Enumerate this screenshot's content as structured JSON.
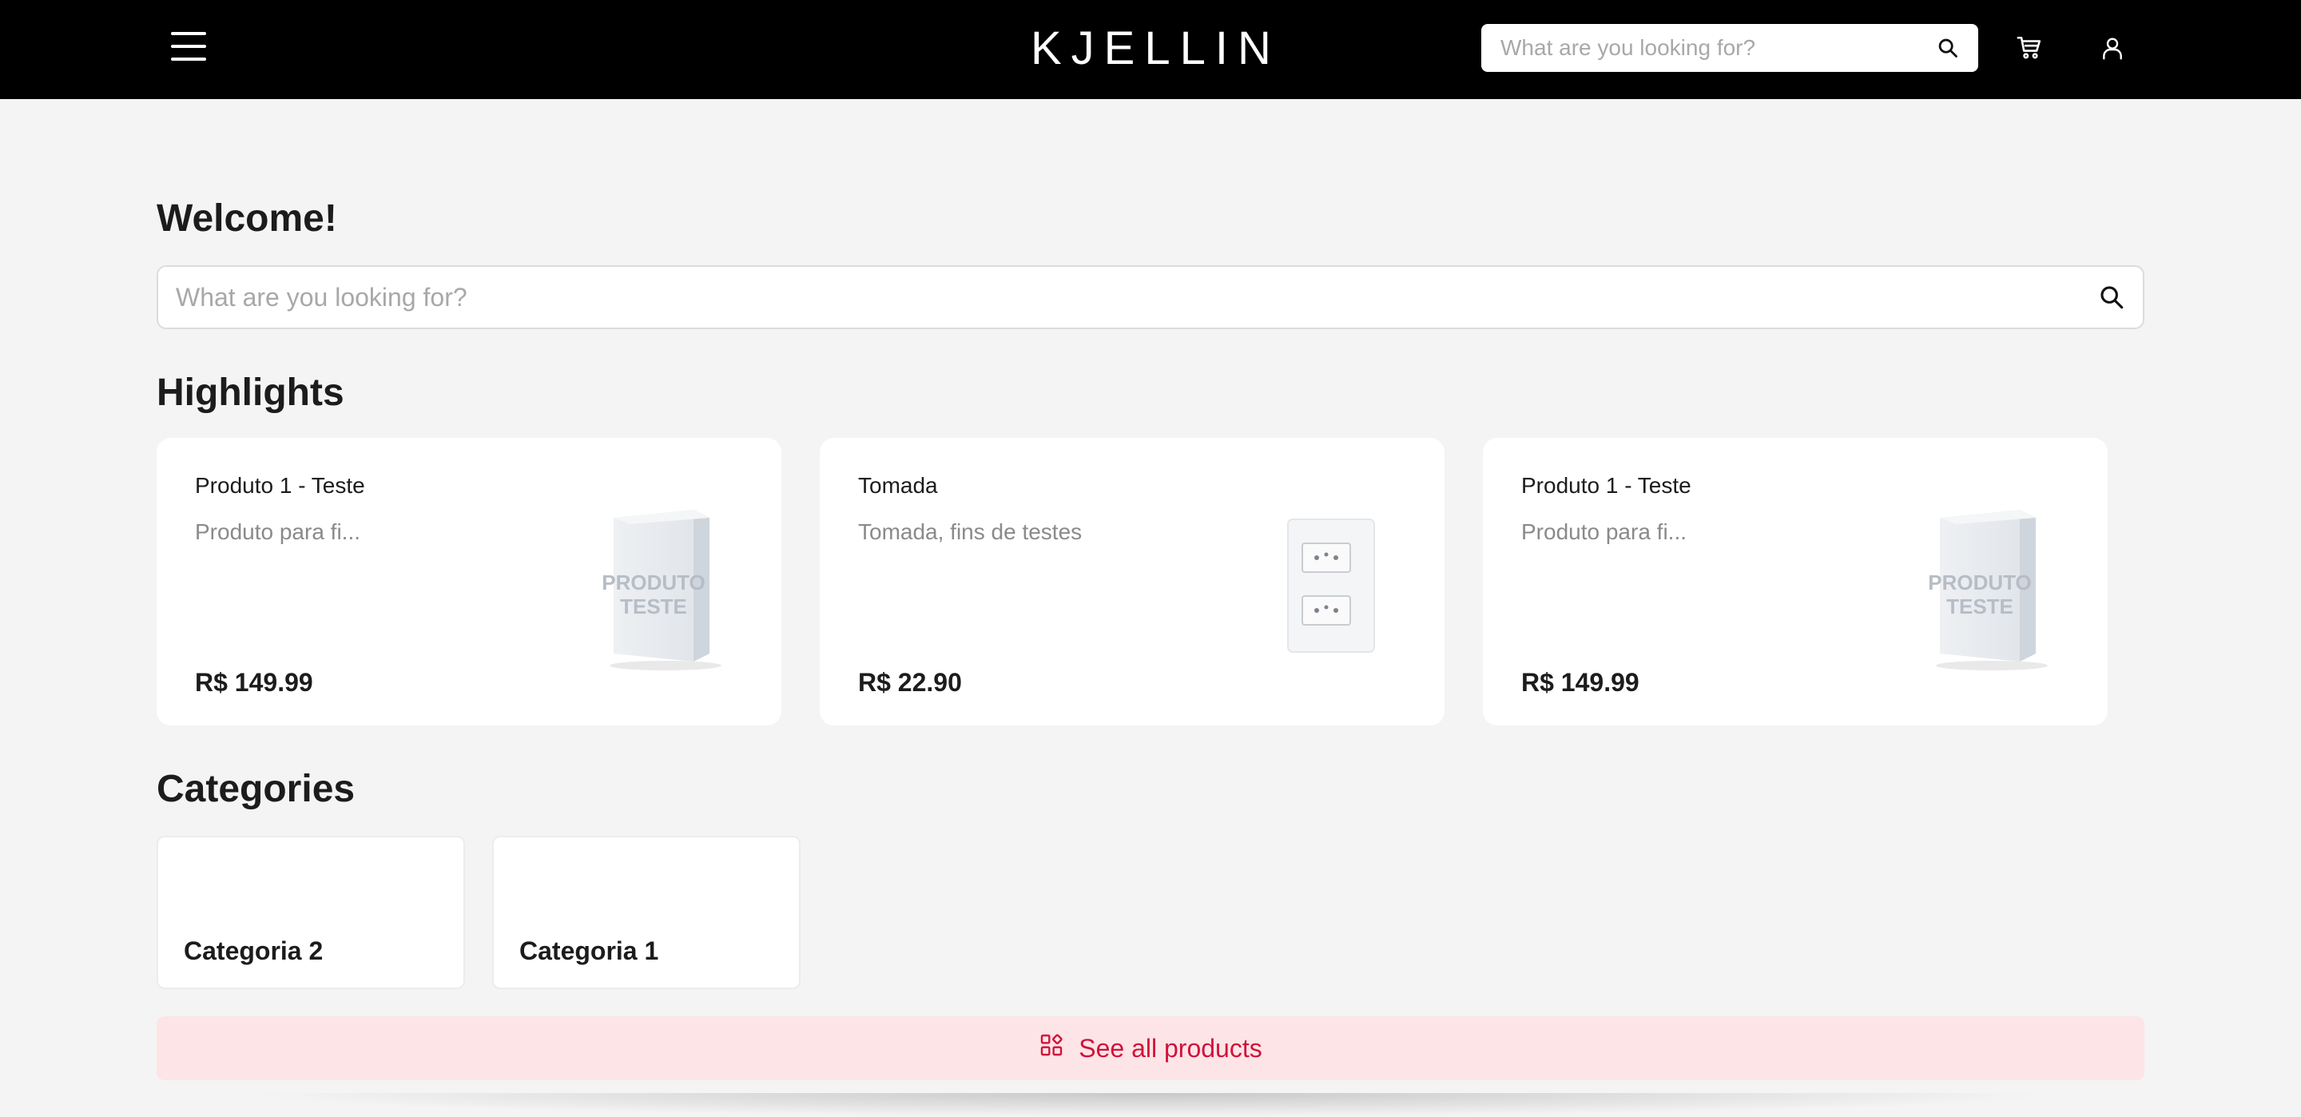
{
  "header": {
    "logo": "KJELLIN",
    "search_placeholder": "What are you looking for?",
    "icons": [
      "menu-icon",
      "search-icon",
      "cart-icon",
      "user-icon"
    ]
  },
  "main": {
    "welcome": "Welcome!",
    "search_placeholder": "What are you looking for?",
    "highlights_title": "Highlights",
    "products": [
      {
        "name": "Produto 1 - Teste",
        "description": "Produto para fi...",
        "price": "R$ 149.99",
        "image": "produto-teste-box",
        "image_text": "PRODUTO TESTE"
      },
      {
        "name": "Tomada",
        "description": "Tomada, fins de testes",
        "price": "R$ 22.90",
        "image": "outlet-plate"
      },
      {
        "name": "Produto 1 - Teste",
        "description": "Produto para fi...",
        "price": "R$ 149.99",
        "image": "produto-teste-box",
        "image_text": "PRODUTO TESTE"
      }
    ],
    "categories_title": "Categories",
    "categories": [
      {
        "name": "Categoria 2"
      },
      {
        "name": "Categoria 1"
      }
    ],
    "see_all_label": "See all products"
  },
  "colors": {
    "header_bg": "#000000",
    "page_bg": "#f4f4f4",
    "accent": "#d0123c",
    "accent_bg": "#fde4e6"
  }
}
